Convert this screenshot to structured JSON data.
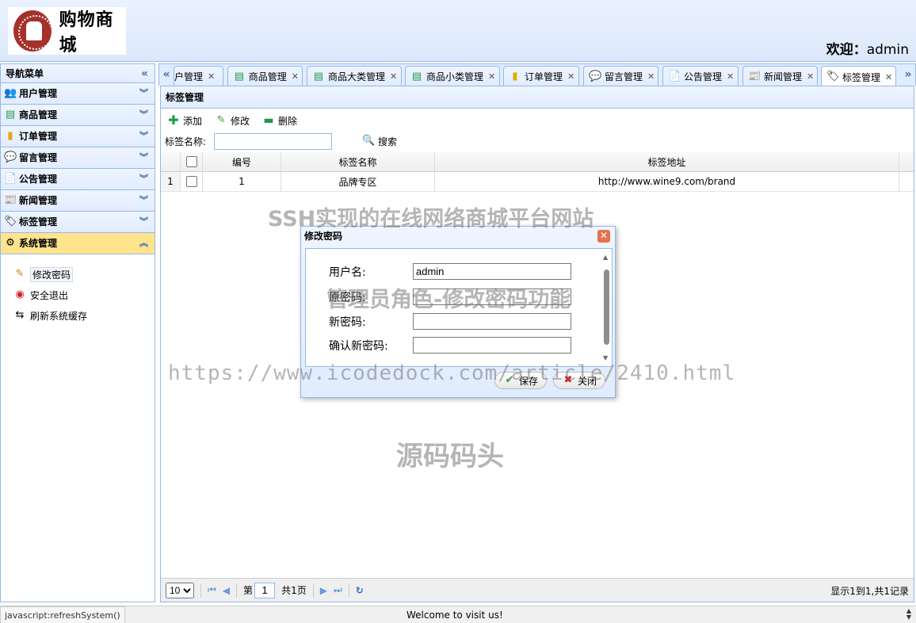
{
  "header": {
    "logo_text": "购物商城",
    "welcome_label": "欢迎：",
    "username": "admin"
  },
  "sidebar": {
    "title": "导航菜单",
    "menus": [
      {
        "label": "用户管理",
        "icon": "users-icon"
      },
      {
        "label": "商品管理",
        "icon": "list-icon"
      },
      {
        "label": "订单管理",
        "icon": "order-icon"
      },
      {
        "label": "留言管理",
        "icon": "message-icon"
      },
      {
        "label": "公告管理",
        "icon": "notice-icon"
      },
      {
        "label": "新闻管理",
        "icon": "news-icon"
      },
      {
        "label": "标签管理",
        "icon": "tag-icon"
      },
      {
        "label": "系统管理",
        "icon": "gear-icon"
      }
    ],
    "sub_items": [
      {
        "label": "修改密码",
        "icon": "edit-icon"
      },
      {
        "label": "安全退出",
        "icon": "exit-icon"
      },
      {
        "label": "刷新系统缓存",
        "icon": "refresh-icon"
      }
    ]
  },
  "tabs": [
    {
      "label": "用户管理"
    },
    {
      "label": "商品管理"
    },
    {
      "label": "商品大类管理"
    },
    {
      "label": "商品小类管理"
    },
    {
      "label": "订单管理"
    },
    {
      "label": "留言管理"
    },
    {
      "label": "公告管理"
    },
    {
      "label": "新闻管理"
    },
    {
      "label": "标签管理"
    }
  ],
  "panel": {
    "title": "标签管理",
    "toolbar": {
      "add": "添加",
      "edit": "修改",
      "delete": "删除"
    },
    "search": {
      "label": "标签名称:",
      "value": "",
      "button": "搜索"
    },
    "columns": [
      "编号",
      "标签名称",
      "标签地址"
    ],
    "rows": [
      {
        "index": "1",
        "id": "1",
        "name": "品牌专区",
        "url": "http://www.wine9.com/brand"
      }
    ],
    "pager": {
      "page_size": "10",
      "page_prefix": "第",
      "page_value": "1",
      "page_total": "共1页",
      "info": "显示1到1,共1记录"
    }
  },
  "dialog": {
    "title": "修改密码",
    "fields": [
      {
        "label": "用户名:",
        "value": "admin"
      },
      {
        "label": "原密码:",
        "value": ""
      },
      {
        "label": "新密码:",
        "value": ""
      },
      {
        "label": "确认新密码:",
        "value": ""
      }
    ],
    "save": "保存",
    "close": "关闭"
  },
  "watermarks": {
    "line1": "SSH实现的在线网络商城平台网站",
    "line2": "管理员角色-修改密码功能",
    "line3": "https://www.icodedock.com/article/2410.html",
    "line4": "源码码头"
  },
  "statusbar": {
    "url": "javascript:refreshSystem()",
    "marquee": "Welcome to visit us!"
  }
}
